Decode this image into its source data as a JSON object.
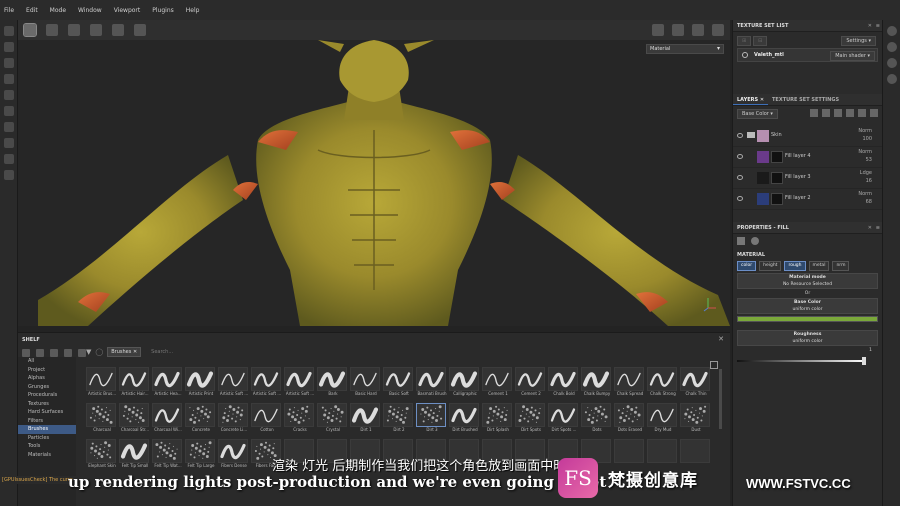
{
  "menu": [
    "File",
    "Edit",
    "Mode",
    "Window",
    "Viewport",
    "Plugins",
    "Help"
  ],
  "viewport": {
    "shading_mode": "Material"
  },
  "texture_set_list": {
    "title": "TEXTURE SET LIST",
    "settings_label": "Settings",
    "row_name": "Valeth_mtl",
    "row_shader": "Main shader"
  },
  "layers_panel": {
    "tab_layers": "LAYERS",
    "tab_tss": "TEXTURE SET SETTINGS",
    "channel": "Base Color",
    "rows": [
      {
        "name": "Skin",
        "blend": "Norm",
        "opacity": "100"
      },
      {
        "name": "Fill layer 4",
        "blend": "Norm",
        "opacity": "53"
      },
      {
        "name": "Fill layer 3",
        "blend": "Ldge",
        "opacity": "16"
      },
      {
        "name": "Fill layer 2",
        "blend": "Norm",
        "opacity": "68"
      }
    ],
    "row_colors": [
      "#b58fb0",
      "#6a3a8a",
      "#1a1a1a",
      "#2b3d7a"
    ]
  },
  "properties": {
    "title": "PROPERTIES - FILL",
    "material_label": "MATERIAL",
    "channels": [
      "color",
      "height",
      "rough",
      "metal",
      "nrm"
    ],
    "active_channels": [
      "color",
      "rough"
    ],
    "material_mode_label": "Material mode",
    "material_mode_value": "No Resource Selected",
    "or_label": "Or",
    "base_color_label": "Base Color",
    "base_color_value": "uniform color",
    "roughness_label": "Roughness",
    "roughness_value": "uniform color",
    "roughness_number": "1",
    "base_color_hex": "#7aa83a"
  },
  "shelf": {
    "title": "SHELF",
    "filter_tag": "Brushes",
    "search_placeholder": "Search...",
    "categories": [
      "All",
      "Project",
      "Alphas",
      "Grunges",
      "Procedurals",
      "Textures",
      "Hard Surfaces",
      "Filters",
      "Brushes",
      "Particles",
      "Tools",
      "Materials"
    ],
    "selected_category": "Brushes",
    "brushes": [
      "Artistic Brus...",
      "Artistic Hair...",
      "Artistic Hea...",
      "Artistic Print",
      "Artistic Soft ...",
      "Artistic Soft ...",
      "Artistic Soft ...",
      "Bark",
      "Basic Hard",
      "Basic Soft",
      "Basmati Brush",
      "Calligraphic",
      "Cement 1",
      "Cement 2",
      "Chalk Bold",
      "Chalk Bumpy",
      "Chalk Spread",
      "Chalk Strong",
      "Chalk Thin",
      "Charcoal",
      "Charcoal Str...",
      "Charcoal Wi...",
      "Concrete",
      "Concrete Li...",
      "Cotton",
      "Cracks",
      "Crystal",
      "Dirt 1",
      "Dirt 2",
      "Dirt 3",
      "Dirt Brushed",
      "Dirt Splash",
      "Dirt Spots",
      "Dirt Spots ...",
      "Dots",
      "Dots Erased",
      "Dry Mud",
      "Dust",
      "Elephant Skin",
      "Felt Tip Small",
      "Felt Tip Wat...",
      "Felt Tip Large",
      "Fibers Dense",
      "Fibers Fade",
      "",
      "",
      "",
      "",
      "",
      "",
      "",
      "",
      "",
      "",
      "",
      "",
      ""
    ],
    "selected_brush": "Dirt 3"
  },
  "status_text": "[GPUIssuesCheck] The curre",
  "subtitle_cn": "渲染 灯光 后期制作当我们把这个角色放到画面中时",
  "subtitle_en": "up rendering lights post-production and we're even going to set",
  "watermark": {
    "badge": "FS",
    "name_cn": "梵摄创意库",
    "url": "WWW.FSTVC.CC"
  }
}
